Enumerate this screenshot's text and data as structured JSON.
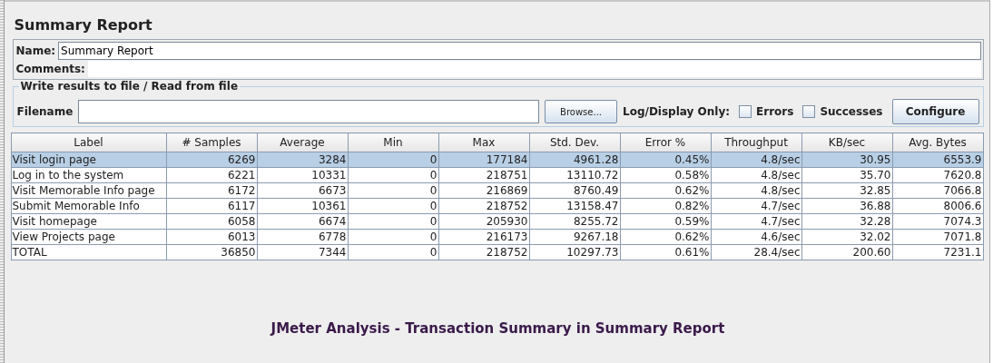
{
  "panel": {
    "title": "Summary Report",
    "name_field": {
      "label": "Name:",
      "value": "Summary Report"
    },
    "comments_field": {
      "label": "Comments:"
    },
    "file_group": {
      "title": "Write results to file / Read from file",
      "filename_label": "Filename",
      "browse_button": "Browse...",
      "log_label": "Log/Display Only:",
      "checkboxes": [
        {
          "label": "Errors",
          "checked": false
        },
        {
          "label": "Successes",
          "checked": false
        }
      ],
      "configure_button": "Configure"
    },
    "table": {
      "columns": [
        "Label",
        "# Samples",
        "Average",
        "Min",
        "Max",
        "Std. Dev.",
        "Error %",
        "Throughput",
        "KB/sec",
        "Avg. Bytes"
      ],
      "rows": [
        {
          "selected": true,
          "cells": [
            "Visit login page",
            "6269",
            "3284",
            "0",
            "177184",
            "4961.28",
            "0.45%",
            "4.8/sec",
            "30.95",
            "6553.9"
          ]
        },
        {
          "selected": false,
          "cells": [
            "Log in to the system",
            "6221",
            "10331",
            "0",
            "218751",
            "13110.72",
            "0.58%",
            "4.8/sec",
            "35.70",
            "7620.8"
          ]
        },
        {
          "selected": false,
          "cells": [
            "Visit Memorable Info page",
            "6172",
            "6673",
            "0",
            "216869",
            "8760.49",
            "0.62%",
            "4.8/sec",
            "32.85",
            "7066.8"
          ]
        },
        {
          "selected": false,
          "cells": [
            "Submit Memorable Info",
            "6117",
            "10361",
            "0",
            "218752",
            "13158.47",
            "0.82%",
            "4.7/sec",
            "36.88",
            "8006.6"
          ]
        },
        {
          "selected": false,
          "cells": [
            "Visit homepage",
            "6058",
            "6674",
            "0",
            "205930",
            "8255.72",
            "0.59%",
            "4.7/sec",
            "32.28",
            "7074.3"
          ]
        },
        {
          "selected": false,
          "cells": [
            "View Projects page",
            "6013",
            "6778",
            "0",
            "216173",
            "9267.18",
            "0.62%",
            "4.6/sec",
            "32.02",
            "7071.8"
          ]
        },
        {
          "selected": false,
          "cells": [
            "TOTAL",
            "36850",
            "7344",
            "0",
            "218752",
            "10297.73",
            "0.61%",
            "28.4/sec",
            "200.60",
            "7231.1"
          ]
        }
      ]
    }
  },
  "caption": "JMeter Analysis - Transaction Summary in Summary Report"
}
